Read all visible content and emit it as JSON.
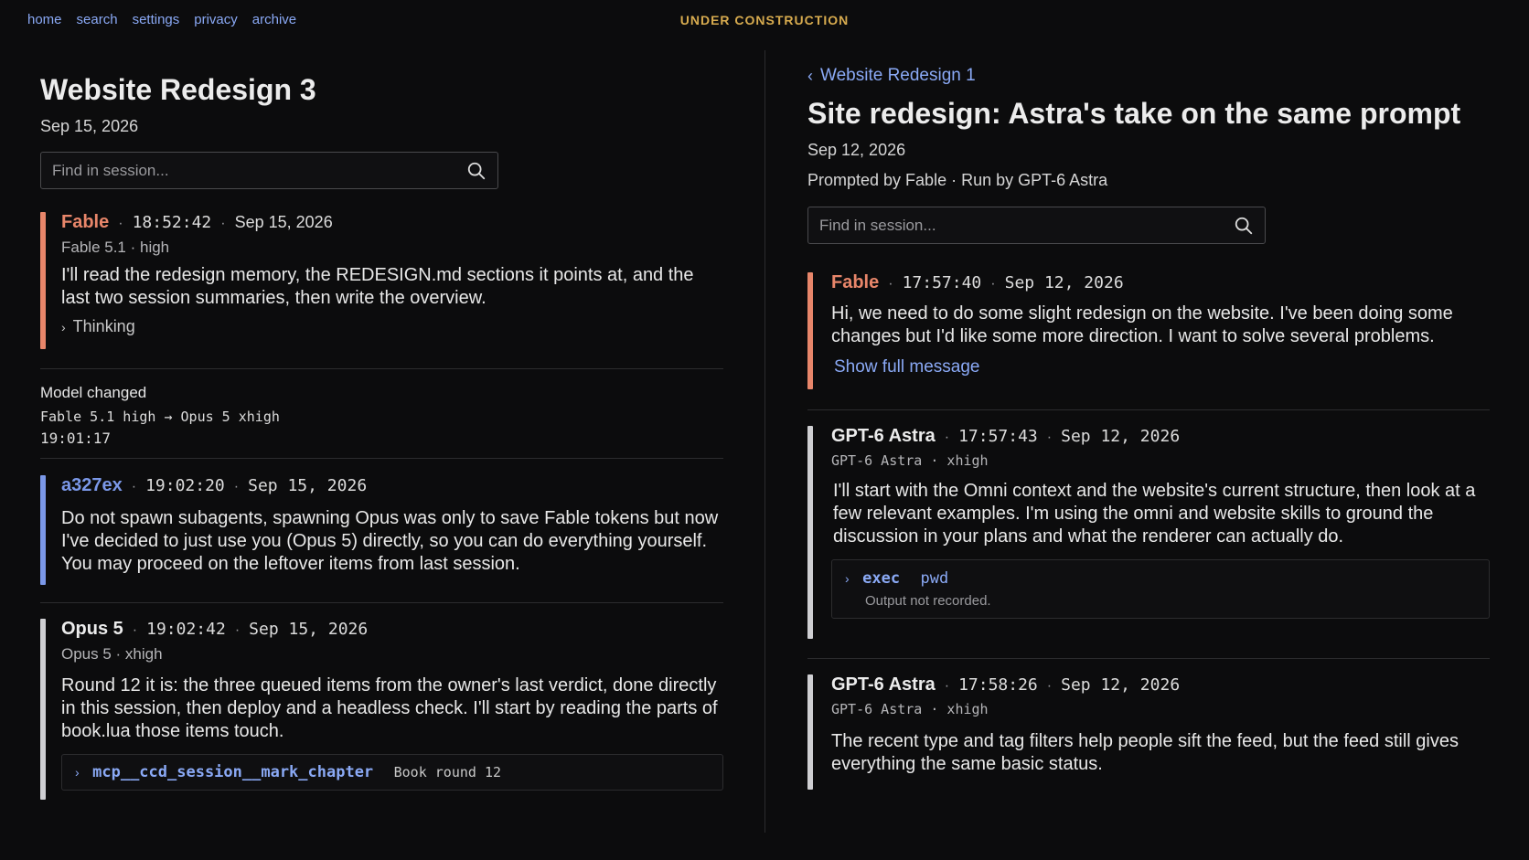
{
  "nav": {
    "items": [
      "home",
      "search",
      "settings",
      "privacy",
      "archive"
    ]
  },
  "banner": "UNDER CONSTRUCTION",
  "left": {
    "title": "Website Redesign 3",
    "date": "Sep 15, 2026",
    "search_placeholder": "Find in session...",
    "msg1": {
      "author": "Fable",
      "time": "18:52:42",
      "date": "Sep 15, 2026",
      "meta": "Fable 5.1 · high",
      "body": "I'll read the redesign memory, the REDESIGN.md sections it points at, and the last two session summaries, then write the overview.",
      "thinking": "Thinking"
    },
    "model_change": {
      "label": "Model changed",
      "detail": "Fable 5.1 high → Opus 5 xhigh",
      "time": "19:01:17"
    },
    "msg2": {
      "author": "a327ex",
      "time": "19:02:20",
      "date": "Sep 15, 2026",
      "body": "Do not spawn subagents, spawning Opus was only to save Fable tokens but now I've decided to just use you (Opus 5) directly, so you can do everything yourself. You may proceed on the leftover items from last session."
    },
    "msg3": {
      "author": "Opus 5",
      "time": "19:02:42",
      "date": "Sep 15, 2026",
      "meta": "Opus 5 · xhigh",
      "body": "Round 12 it is: the three queued items from the owner's last verdict, done directly in this session, then deploy and a headless check. I'll start by reading the parts of book.lua those items touch.",
      "tool": {
        "name": "mcp__ccd_session__mark_chapter",
        "arg": "Book round 12"
      }
    }
  },
  "right": {
    "back_link": "Website Redesign 1",
    "title": "Site redesign: Astra's take on the same prompt",
    "date": "Sep 12, 2026",
    "subtitle": "Prompted by Fable · Run by GPT-6 Astra",
    "search_placeholder": "Find in session...",
    "msg1": {
      "author": "Fable",
      "time": "17:57:40",
      "date": "Sep 12, 2026",
      "body": "Hi, we need to do some slight redesign on the website. I've been doing some changes but I'd like some more direction. I want to solve several problems.",
      "show_full": "Show full message"
    },
    "msg2": {
      "author": "GPT-6 Astra",
      "time": "17:57:43",
      "date": "Sep 12, 2026",
      "meta": "GPT-6 Astra · xhigh",
      "body": "I'll start with the Omni context and the website's current structure, then look at a few relevant examples. I'm using the omni and website skills to ground the discussion in your plans and what the renderer can actually do.",
      "tool": {
        "name": "exec",
        "arg": "pwd",
        "desc": "Output not recorded."
      }
    },
    "msg3": {
      "author": "GPT-6 Astra",
      "time": "17:58:26",
      "date": "Sep 12, 2026",
      "meta": "GPT-6 Astra · xhigh",
      "body": "The recent type and tag filters help people sift the feed, but the feed still gives everything the same basic status."
    }
  },
  "colors": {
    "fable_accent": "#e8866a",
    "user_accent": "#7b98e8",
    "model_accent": "#cfcfd2",
    "link": "#8aa9f5",
    "banner": "#d7ab4f"
  }
}
